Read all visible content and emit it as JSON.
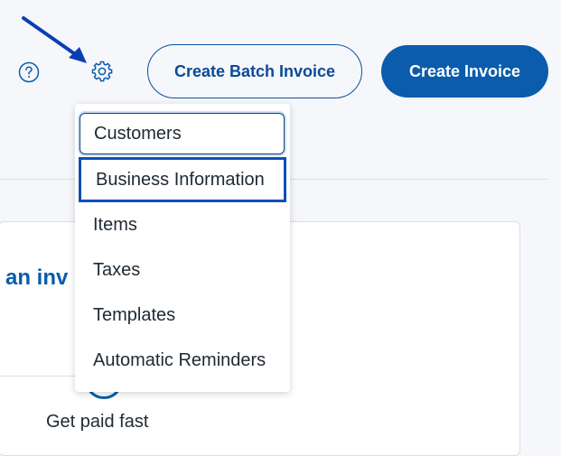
{
  "header": {
    "help_icon": "question-circle-icon",
    "settings_icon": "gear-icon",
    "create_batch_invoice_label": "Create Batch Invoice",
    "create_invoice_label": "Create Invoice"
  },
  "settings_menu": {
    "items": [
      {
        "label": "Customers",
        "state": "focused"
      },
      {
        "label": "Business Information",
        "state": "highlighted"
      },
      {
        "label": "Items"
      },
      {
        "label": "Taxes"
      },
      {
        "label": "Templates"
      },
      {
        "label": "Automatic Reminders"
      }
    ]
  },
  "card": {
    "title_fragment": "an inv",
    "feature_label": "Get paid fast"
  },
  "annotation": {
    "icon": "arrow-icon",
    "color": "#0a3fb3"
  },
  "colors": {
    "accent": "#0b5cac",
    "highlight_border": "#0d4fb8"
  }
}
